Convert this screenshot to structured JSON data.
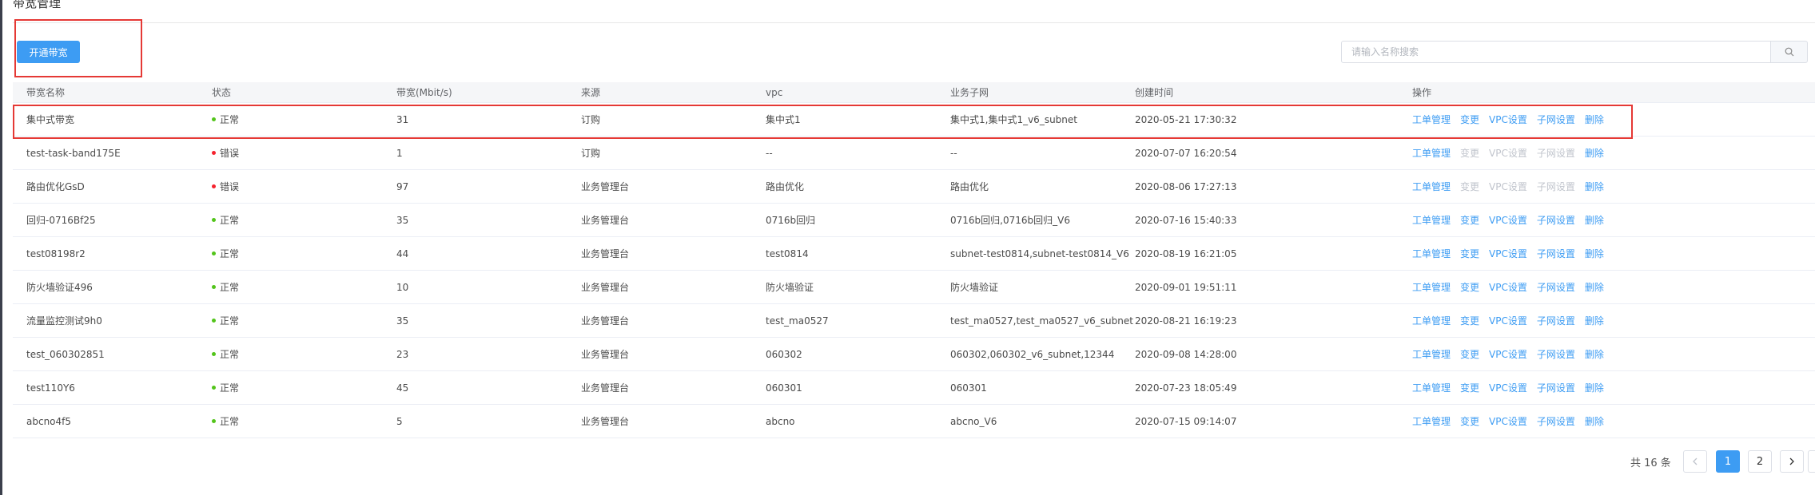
{
  "page": {
    "title": "带宽管理"
  },
  "toolbar": {
    "create_label": "开通带宽"
  },
  "search": {
    "placeholder": "请输入名称搜索",
    "value": ""
  },
  "colors": {
    "accent": "#3d9cf3",
    "ok": "#52c41a",
    "error": "#f5222d",
    "annotation": "#e53935"
  },
  "table": {
    "columns": [
      "带宽名称",
      "状态",
      "带宽(Mbit/s)",
      "来源",
      "vpc",
      "业务子网",
      "创建时间",
      "操作"
    ],
    "rows": [
      {
        "name": "集中式带宽",
        "status": "正常",
        "status_type": "ok",
        "bandwidth": "31",
        "source": "订购",
        "vpc": "集中式1",
        "subnet": "集中式1,集中式1_v6_subnet",
        "created": "2020-05-21 17:30:32",
        "ops_disabled": false
      },
      {
        "name": "test-task-band175E",
        "status": "错误",
        "status_type": "error",
        "bandwidth": "1",
        "source": "订购",
        "vpc": "--",
        "subnet": "--",
        "created": "2020-07-07 16:20:54",
        "ops_disabled": true
      },
      {
        "name": "路由优化GsD",
        "status": "错误",
        "status_type": "error",
        "bandwidth": "97",
        "source": "业务管理台",
        "vpc": "路由优化",
        "subnet": "路由优化",
        "created": "2020-08-06 17:27:13",
        "ops_disabled": true
      },
      {
        "name": "回归-0716Bf25",
        "status": "正常",
        "status_type": "ok",
        "bandwidth": "35",
        "source": "业务管理台",
        "vpc": "0716b回归",
        "subnet": "0716b回归,0716b回归_V6",
        "created": "2020-07-16 15:40:33",
        "ops_disabled": false
      },
      {
        "name": "test08198r2",
        "status": "正常",
        "status_type": "ok",
        "bandwidth": "44",
        "source": "业务管理台",
        "vpc": "test0814",
        "subnet": "subnet-test0814,subnet-test0814_V6",
        "created": "2020-08-19 16:21:05",
        "ops_disabled": false
      },
      {
        "name": "防火墙验证496",
        "status": "正常",
        "status_type": "ok",
        "bandwidth": "10",
        "source": "业务管理台",
        "vpc": "防火墙验证",
        "subnet": "防火墙验证",
        "created": "2020-09-01 19:51:11",
        "ops_disabled": false
      },
      {
        "name": "流量监控测试9h0",
        "status": "正常",
        "status_type": "ok",
        "bandwidth": "35",
        "source": "业务管理台",
        "vpc": "test_ma0527",
        "subnet": "test_ma0527,test_ma0527_v6_subnet",
        "created": "2020-08-21 16:19:23",
        "ops_disabled": false
      },
      {
        "name": "test_060302851",
        "status": "正常",
        "status_type": "ok",
        "bandwidth": "23",
        "source": "业务管理台",
        "vpc": "060302",
        "subnet": "060302,060302_v6_subnet,12344",
        "created": "2020-09-08 14:28:00",
        "ops_disabled": false
      },
      {
        "name": "test110Y6",
        "status": "正常",
        "status_type": "ok",
        "bandwidth": "45",
        "source": "业务管理台",
        "vpc": "060301",
        "subnet": "060301",
        "created": "2020-07-23 18:05:49",
        "ops_disabled": false
      },
      {
        "name": "abcno4f5",
        "status": "正常",
        "status_type": "ok",
        "bandwidth": "5",
        "source": "业务管理台",
        "vpc": "abcno",
        "subnet": "abcno_V6",
        "created": "2020-07-15 09:14:07",
        "ops_disabled": false
      }
    ],
    "ops": [
      "工单管理",
      "变更",
      "VPC设置",
      "子网设置",
      "删除"
    ]
  },
  "pagination": {
    "total_text": "共 16 条",
    "pages": [
      "1",
      "2"
    ],
    "current": "1",
    "prev_icon": "chevron-left-icon",
    "next_icon": "chevron-right-icon"
  }
}
